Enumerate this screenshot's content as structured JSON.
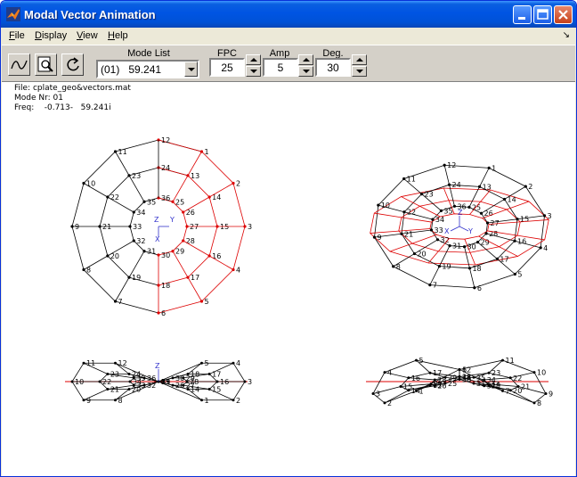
{
  "window": {
    "title": "Modal Vector Animation"
  },
  "menu": {
    "items": [
      {
        "label": "File",
        "key": "F"
      },
      {
        "label": "Display",
        "key": "D"
      },
      {
        "label": "View",
        "key": "V"
      },
      {
        "label": "Help",
        "key": "H"
      }
    ]
  },
  "toolbar": {
    "mode_list_label": "Mode List",
    "mode_selected": "(01)   59.241",
    "fpc_label": "FPC",
    "fpc_value": "25",
    "amp_label": "Amp",
    "amp_value": "5",
    "deg_label": "Deg.",
    "deg_value": "30"
  },
  "info": {
    "file": "File: cplate_geo&vectors.mat",
    "mode": "Mode Nr: 01",
    "freq": "Freq:    -0.713-   59.241i"
  },
  "colors": {
    "deformed": "#dd0000",
    "undeformed": "#000000",
    "axes": "#3333cc"
  },
  "axes_labels": {
    "z": "Z",
    "y": "Y",
    "x": "X"
  },
  "views": {
    "top_view_labels": [
      "1",
      "2",
      "3",
      "4",
      "5",
      "6",
      "7",
      "8",
      "9",
      "10",
      "11",
      "12",
      "13",
      "14",
      "15",
      "16",
      "17",
      "18",
      "19",
      "20",
      "21",
      "22",
      "23",
      "24",
      "25",
      "26",
      "27",
      "28",
      "29",
      "30",
      "31",
      "32",
      "33",
      "34",
      "35",
      "36"
    ],
    "iso_view_labels": [
      "1",
      "2",
      "3",
      "4",
      "5",
      "6",
      "7",
      "8",
      "9",
      "10",
      "11",
      "12",
      "13",
      "14",
      "15",
      "16",
      "17",
      "18",
      "19",
      "20",
      "21",
      "22",
      "23",
      "24",
      "25",
      "26",
      "27",
      "28",
      "29",
      "30",
      "31",
      "32",
      "33",
      "34",
      "35",
      "36"
    ],
    "front_view_labels": [
      "1",
      "2",
      "3",
      "4",
      "5",
      "6",
      "8",
      "9",
      "10",
      "11",
      "12",
      "13",
      "14",
      "15",
      "16",
      "17",
      "18",
      "19",
      "20",
      "21",
      "22",
      "23",
      "24",
      "25",
      "26",
      "27",
      "28",
      "29",
      "30",
      "31",
      "32",
      "33",
      "34",
      "35",
      "36"
    ],
    "side_view_labels": [
      "1",
      "2",
      "3",
      "4",
      "5",
      "6",
      "7",
      "8",
      "9",
      "10",
      "11",
      "12",
      "13",
      "14",
      "15",
      "16",
      "17",
      "18",
      "19",
      "20",
      "21",
      "22",
      "23",
      "24",
      "25",
      "26",
      "27",
      "28",
      "29",
      "30",
      "31",
      "32",
      "33",
      "34",
      "35",
      "36"
    ]
  }
}
